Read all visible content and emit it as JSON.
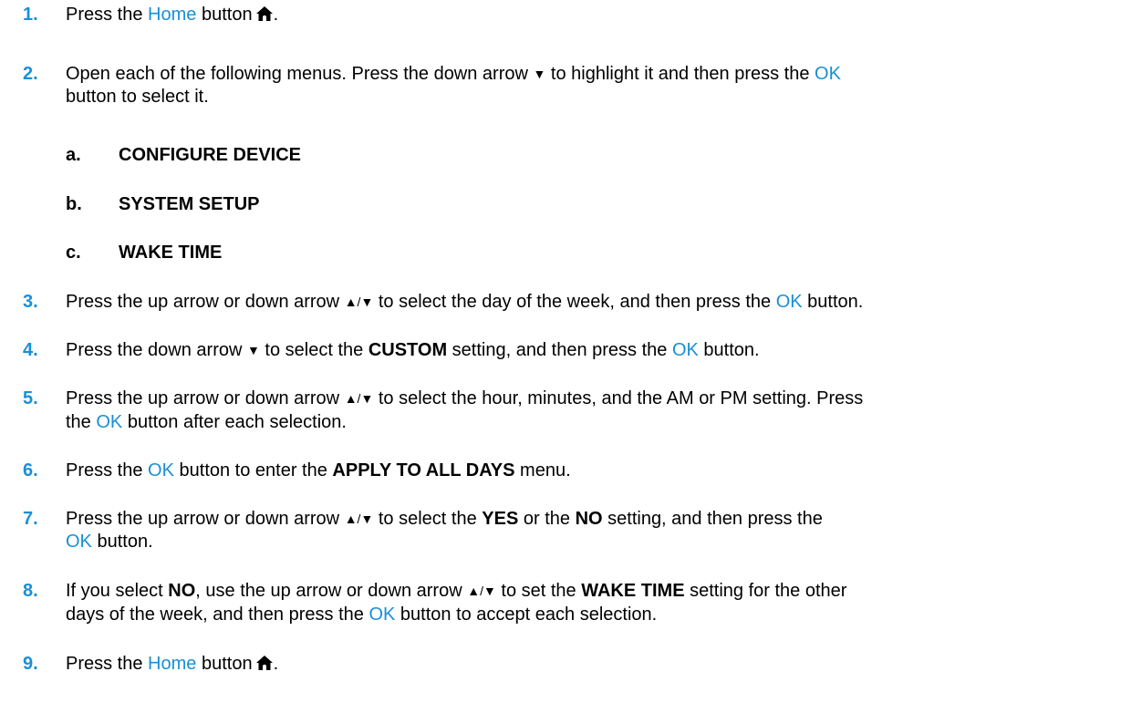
{
  "colors": {
    "accent": "#1a8fd6",
    "text": "#000000"
  },
  "icons": {
    "home": "home-icon",
    "down": "down-arrow-icon",
    "updown": "up-down-arrow-icon"
  },
  "steps": [
    {
      "num": "1.",
      "pre": "Press the ",
      "home": "Home",
      "post": " button",
      "end": "."
    },
    {
      "num": "2.",
      "pre": "Open each of the following menus. Press the down arrow",
      "mid": " to highlight it and then press the ",
      "ok": "OK",
      "line2": "button to select it."
    },
    {
      "num": "3.",
      "pre": "Press the up arrow or down arrow",
      "post": " to select the day of the week, and then press the ",
      "ok": "OK",
      "end": " button."
    },
    {
      "num": "4.",
      "pre": "Press the down arrow",
      "mid": " to select the ",
      "bold": "CUSTOM",
      "post": " setting, and then press the ",
      "ok": "OK",
      "end": " button."
    },
    {
      "num": "5.",
      "pre": "Press the up arrow or down arrow",
      "post": " to select the hour, minutes, and the AM or PM setting. Press",
      "line2pre": "the ",
      "ok": "OK",
      "line2post": " button after each selection."
    },
    {
      "num": "6.",
      "pre": "Press the ",
      "ok": "OK",
      "mid": " button to enter the ",
      "bold": "APPLY TO ALL DAYS",
      "end": " menu."
    },
    {
      "num": "7.",
      "pre": "Press the up arrow or down arrow",
      "mid": " to select the ",
      "bold1": "YES",
      "mid2": " or the ",
      "bold2": "NO",
      "post": " setting, and then press the",
      "ok": "OK",
      "line2post": " button."
    },
    {
      "num": "8.",
      "pre": "If you select ",
      "bold1": "NO",
      "mid": ", use the up arrow or down arrow",
      "mid2": " to set the ",
      "bold2": "WAKE TIME",
      "post": " setting for the other",
      "line2pre": "days of the week, and then press the ",
      "ok": "OK",
      "line2post": " button to accept each selection."
    },
    {
      "num": "9.",
      "pre": "Press the ",
      "home": "Home",
      "post": " button",
      "end": "."
    }
  ],
  "substeps": [
    {
      "letter": "a.",
      "text": "CONFIGURE DEVICE"
    },
    {
      "letter": "b.",
      "text": "SYSTEM SETUP"
    },
    {
      "letter": "c.",
      "text": "WAKE TIME"
    }
  ],
  "glyphs": {
    "down": "▼",
    "updown": "▲/▼"
  }
}
